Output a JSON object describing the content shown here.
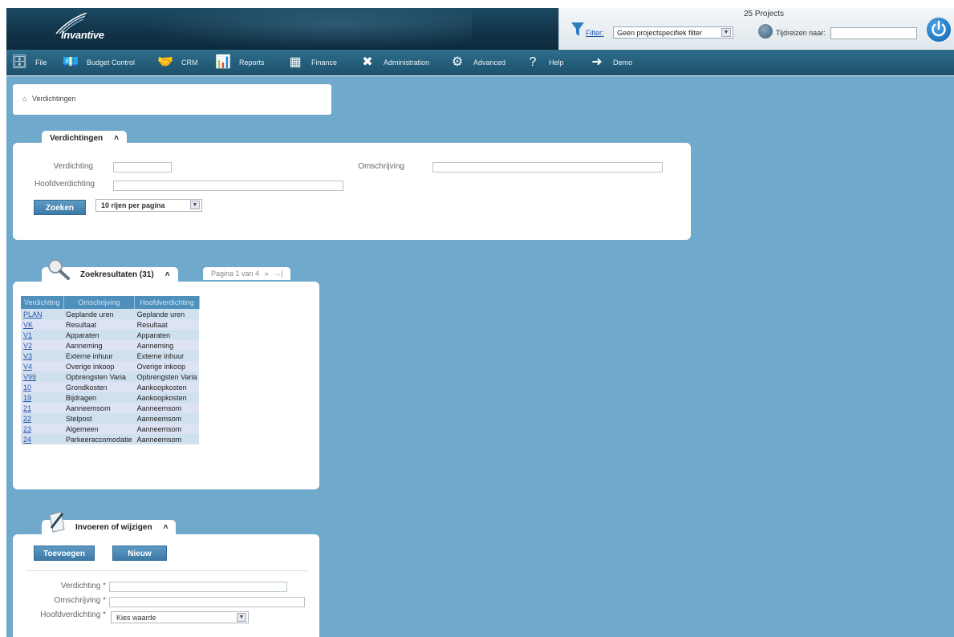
{
  "header": {
    "logo_text": "Invantive",
    "projects_count": "25 Projects",
    "filter_label": "Filter:",
    "filter_value": "Geen projectspecifiek filter",
    "time_travel_label": "Tijdreizen naar:",
    "time_travel_value": ""
  },
  "nav": {
    "items": [
      {
        "label": "File",
        "icon": "file-cabinet-icon"
      },
      {
        "label": "Budget Control",
        "icon": "budget-icon"
      },
      {
        "label": "CRM",
        "icon": "handshake-icon"
      },
      {
        "label": "Reports",
        "icon": "reports-icon"
      },
      {
        "label": "Finance",
        "icon": "calculator-icon"
      },
      {
        "label": "Administration",
        "icon": "tools-icon"
      },
      {
        "label": "Advanced",
        "icon": "gears-icon"
      },
      {
        "label": "Help",
        "icon": "help-icon"
      },
      {
        "label": "Demo",
        "icon": "demo-icon"
      }
    ]
  },
  "breadcrumb": {
    "label": "Verdichtingen"
  },
  "search_panel": {
    "tab_label": "Verdichtingen",
    "collapse_glyph": "˄",
    "fields": {
      "verdichting_label": "Verdichting",
      "verdichting_value": "",
      "omschrijving_label": "Omschrijving",
      "omschrijving_value": "",
      "hoofdverdichting_label": "Hoofdverdichting",
      "hoofdverdichting_value": ""
    },
    "search_button": "Zoeken",
    "rows_per_page": "10 rijen per pagina"
  },
  "results_panel": {
    "tab_label": "Zoekresultaten (31)",
    "collapse_glyph": "˄",
    "pager": "Pagina 1 van 4",
    "pager_next": "»",
    "pager_last": "→|",
    "columns": [
      "Verdichting",
      "Omschrijving",
      "Hoofdverdichting"
    ],
    "rows": [
      [
        "PLAN",
        "Geplande uren",
        "Geplande uren"
      ],
      [
        "VK",
        "Resultaat",
        "Resultaat"
      ],
      [
        "V1",
        "Apparaten",
        "Apparaten"
      ],
      [
        "V2",
        "Aanneming",
        "Aanneming"
      ],
      [
        "V3",
        "Externe inhuur",
        "Externe inhuur"
      ],
      [
        "V4",
        "Overige inkoop",
        "Overige inkoop"
      ],
      [
        "V99",
        "Opbrengsten Varia",
        "Opbrengsten Varia"
      ],
      [
        "10",
        "Grondkosten",
        "Aankoopkosten"
      ],
      [
        "19",
        "Bijdragen",
        "Aankoopkosten"
      ],
      [
        "21",
        "Aanneemsom",
        "Aanneemsom"
      ],
      [
        "22",
        "Stelpost",
        "Aanneemsom"
      ],
      [
        "23",
        "Algemeen",
        "Aanneemsom"
      ],
      [
        "24",
        "Parkeeraccomodatie",
        "Aanneemsom"
      ]
    ]
  },
  "edit_panel": {
    "tab_label": "Invoeren of wijzigen",
    "collapse_glyph": "˄",
    "add_button": "Toevoegen",
    "new_button": "Nieuw",
    "verdichting_label": "Verdichting *",
    "omschrijving_label": "Omschrijving *",
    "hoofdverdichting_label": "Hoofdverdichting *",
    "hoofdverdichting_value": "Kies waarde"
  },
  "colors": {
    "background": "#6fa9cc",
    "header": "#113247",
    "nav": "#2e6d8d",
    "button": "#4a87b3"
  }
}
